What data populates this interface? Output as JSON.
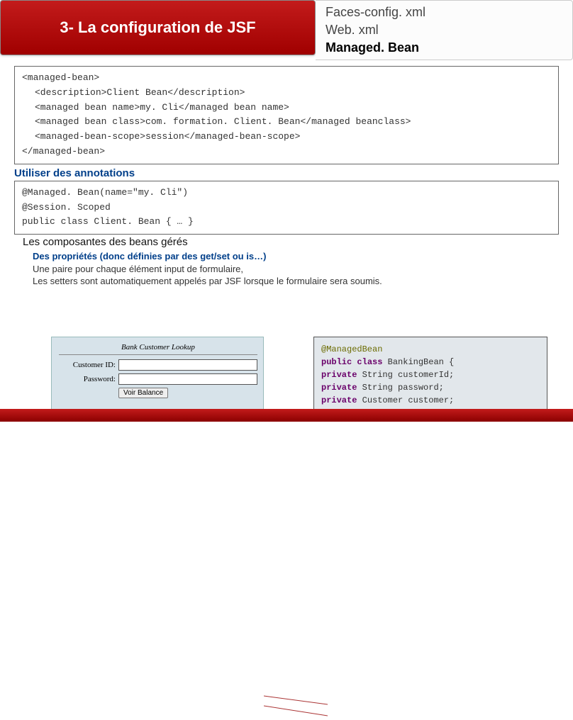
{
  "header": {
    "title": "3- La configuration de JSF",
    "items": [
      "Faces-config. xml",
      "Web. xml",
      "Managed. Bean"
    ]
  },
  "xml": {
    "l0": "<managed-bean>",
    "l1": "<description>Client Bean</description>",
    "l2": "<managed bean name>my. Cli</managed bean name>",
    "l3": "<managed bean class>com. formation. Client. Bean</managed beanclass>",
    "l4": "<managed-bean-scope>session</managed-bean-scope>",
    "l5": "</managed-bean>"
  },
  "annotations": {
    "title": "Utiliser des annotations",
    "l0": "@Managed. Bean(name=\"my. Cli\")",
    "l1": "@Session. Scoped",
    "l2": "public class Client. Bean { … }"
  },
  "components_label": "Les composantes des beans gérés",
  "props": {
    "title": "Des propriétés (donc définies par des get/set ou is…)",
    "line1": "Une paire pour chaque élément input de formulaire,",
    "line2": "Les setters sont automatiquement appelés par JSF lorsque le formulaire sera soumis."
  },
  "form": {
    "title": "Bank Customer Lookup",
    "label_id": "Customer ID:",
    "label_pwd": "Password:",
    "button": "Voir Balance"
  },
  "code": {
    "l0a": "@ManagedBean",
    "l1a": "public",
    "l1b": " class",
    "l1c": " BankingBean {",
    "l2a": "  private",
    "l2b": " String",
    "l2c": " customerId;",
    "l3a": "  private",
    "l3b": " String",
    "l3c": " password;",
    "l4a": "  private",
    "l4b": " Customer",
    "l4c": " customer;"
  }
}
